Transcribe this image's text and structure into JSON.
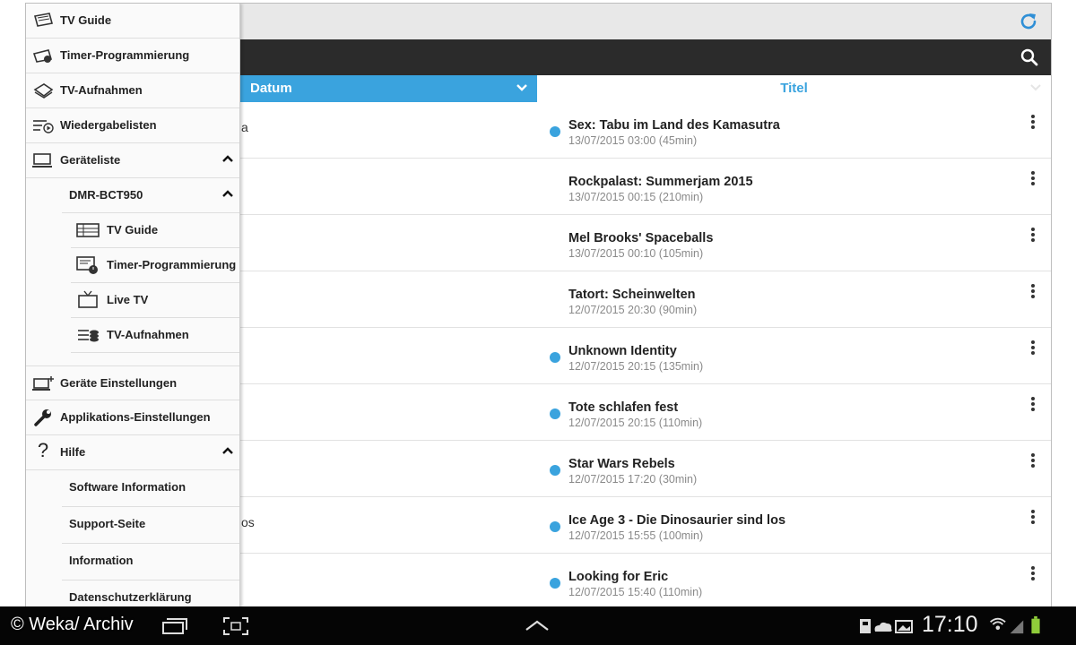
{
  "drawer": {
    "items": [
      {
        "label": "TV Guide",
        "icon": "tv-guide-icon"
      },
      {
        "label": "Timer-Programmierung",
        "icon": "timer-icon"
      },
      {
        "label": "TV-Aufnahmen",
        "icon": "recordings-icon"
      },
      {
        "label": "Wiedergabelisten",
        "icon": "playlist-icon"
      },
      {
        "label": "Geräteliste",
        "icon": "device-icon"
      }
    ],
    "device_name": "DMR-BCT950",
    "device_items": [
      {
        "label": "TV Guide",
        "icon": "tv-guide-list-icon"
      },
      {
        "label": "Timer-Programmierung",
        "icon": "timer-clock-icon"
      },
      {
        "label": "Live TV",
        "icon": "live-tv-icon"
      },
      {
        "label": "TV-Aufnahmen",
        "icon": "stack-icon"
      }
    ],
    "settings": [
      {
        "label": "Geräte Einstellungen",
        "icon": "device-settings-icon"
      },
      {
        "label": "Applikations-Einstellungen",
        "icon": "wrench-icon"
      }
    ],
    "help": {
      "label": "Hilfe",
      "icon": "question-icon"
    },
    "help_items": [
      "Software Information",
      "Support-Seite",
      "Information",
      "Datenschutzerklärung"
    ]
  },
  "columns": {
    "datum": "Datum",
    "titel": "Titel"
  },
  "recordings": [
    {
      "left": "a",
      "title": "Sex: Tabu im Land des Kamasutra",
      "sub": "13/07/2015 03:00 (45min)",
      "new": true
    },
    {
      "left": "",
      "title": "Rockpalast: Summerjam 2015",
      "sub": "13/07/2015 00:15 (210min)",
      "new": false
    },
    {
      "left": "",
      "title": "Mel Brooks' Spaceballs",
      "sub": "13/07/2015 00:10 (105min)",
      "new": false
    },
    {
      "left": "",
      "title": "Tatort: Scheinwelten",
      "sub": "12/07/2015 20:30 (90min)",
      "new": false
    },
    {
      "left": "",
      "title": "Unknown Identity",
      "sub": "12/07/2015 20:15 (135min)",
      "new": true
    },
    {
      "left": "",
      "title": "Tote schlafen fest",
      "sub": "12/07/2015 20:15 (110min)",
      "new": true
    },
    {
      "left": "",
      "title": "Star Wars Rebels",
      "sub": "12/07/2015 17:20 (30min)",
      "new": true
    },
    {
      "left": "os",
      "title": "Ice Age 3 - Die Dinosaurier sind los",
      "sub": "12/07/2015 15:55 (100min)",
      "new": true
    },
    {
      "left": "",
      "title": "Looking for Eric",
      "sub": "12/07/2015 15:40 (110min)",
      "new": true
    }
  ],
  "statusbar": {
    "time": "17:10",
    "watermark": "© Weka/ Archiv"
  },
  "colors": {
    "accent": "#3aa3de",
    "dark_bar": "#2b2b2b",
    "system_bar": "#050505"
  }
}
